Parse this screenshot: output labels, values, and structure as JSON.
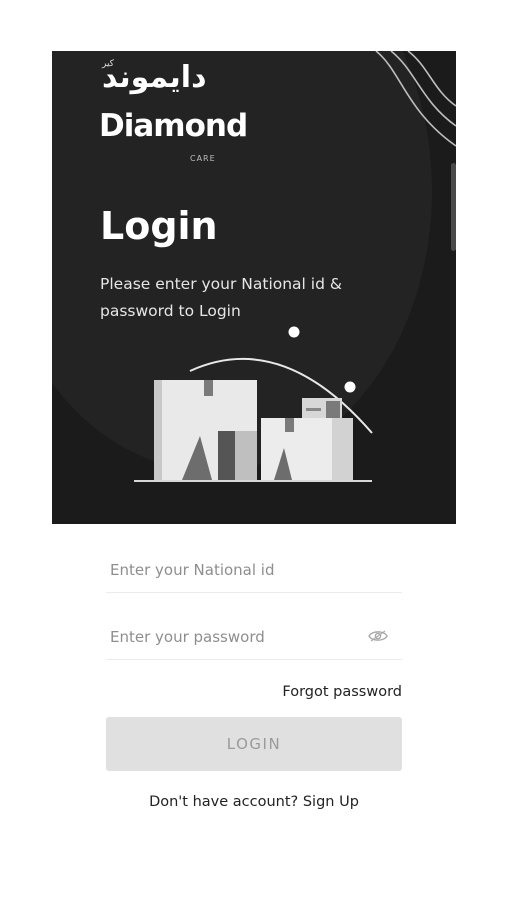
{
  "brand": {
    "arabic_name": "دايموند",
    "arabic_sub": "كير",
    "latin_name": "Diamond",
    "latin_sub": "CARE"
  },
  "hero": {
    "title": "Login",
    "subtitle": "Please enter your National id & password to Login"
  },
  "form": {
    "national_id_placeholder": "Enter your National id",
    "password_placeholder": "Enter your password",
    "forgot_label": "Forgot password",
    "login_label": "LOGIN",
    "signup_prompt": "Don't have account?",
    "signup_label": "Sign Up"
  },
  "icons": {
    "password_toggle": "eye-icon"
  },
  "colors": {
    "hero_background": "#1b1b1b",
    "button_disabled": "#e0e0e0",
    "button_text_disabled": "#9a9a9a"
  }
}
